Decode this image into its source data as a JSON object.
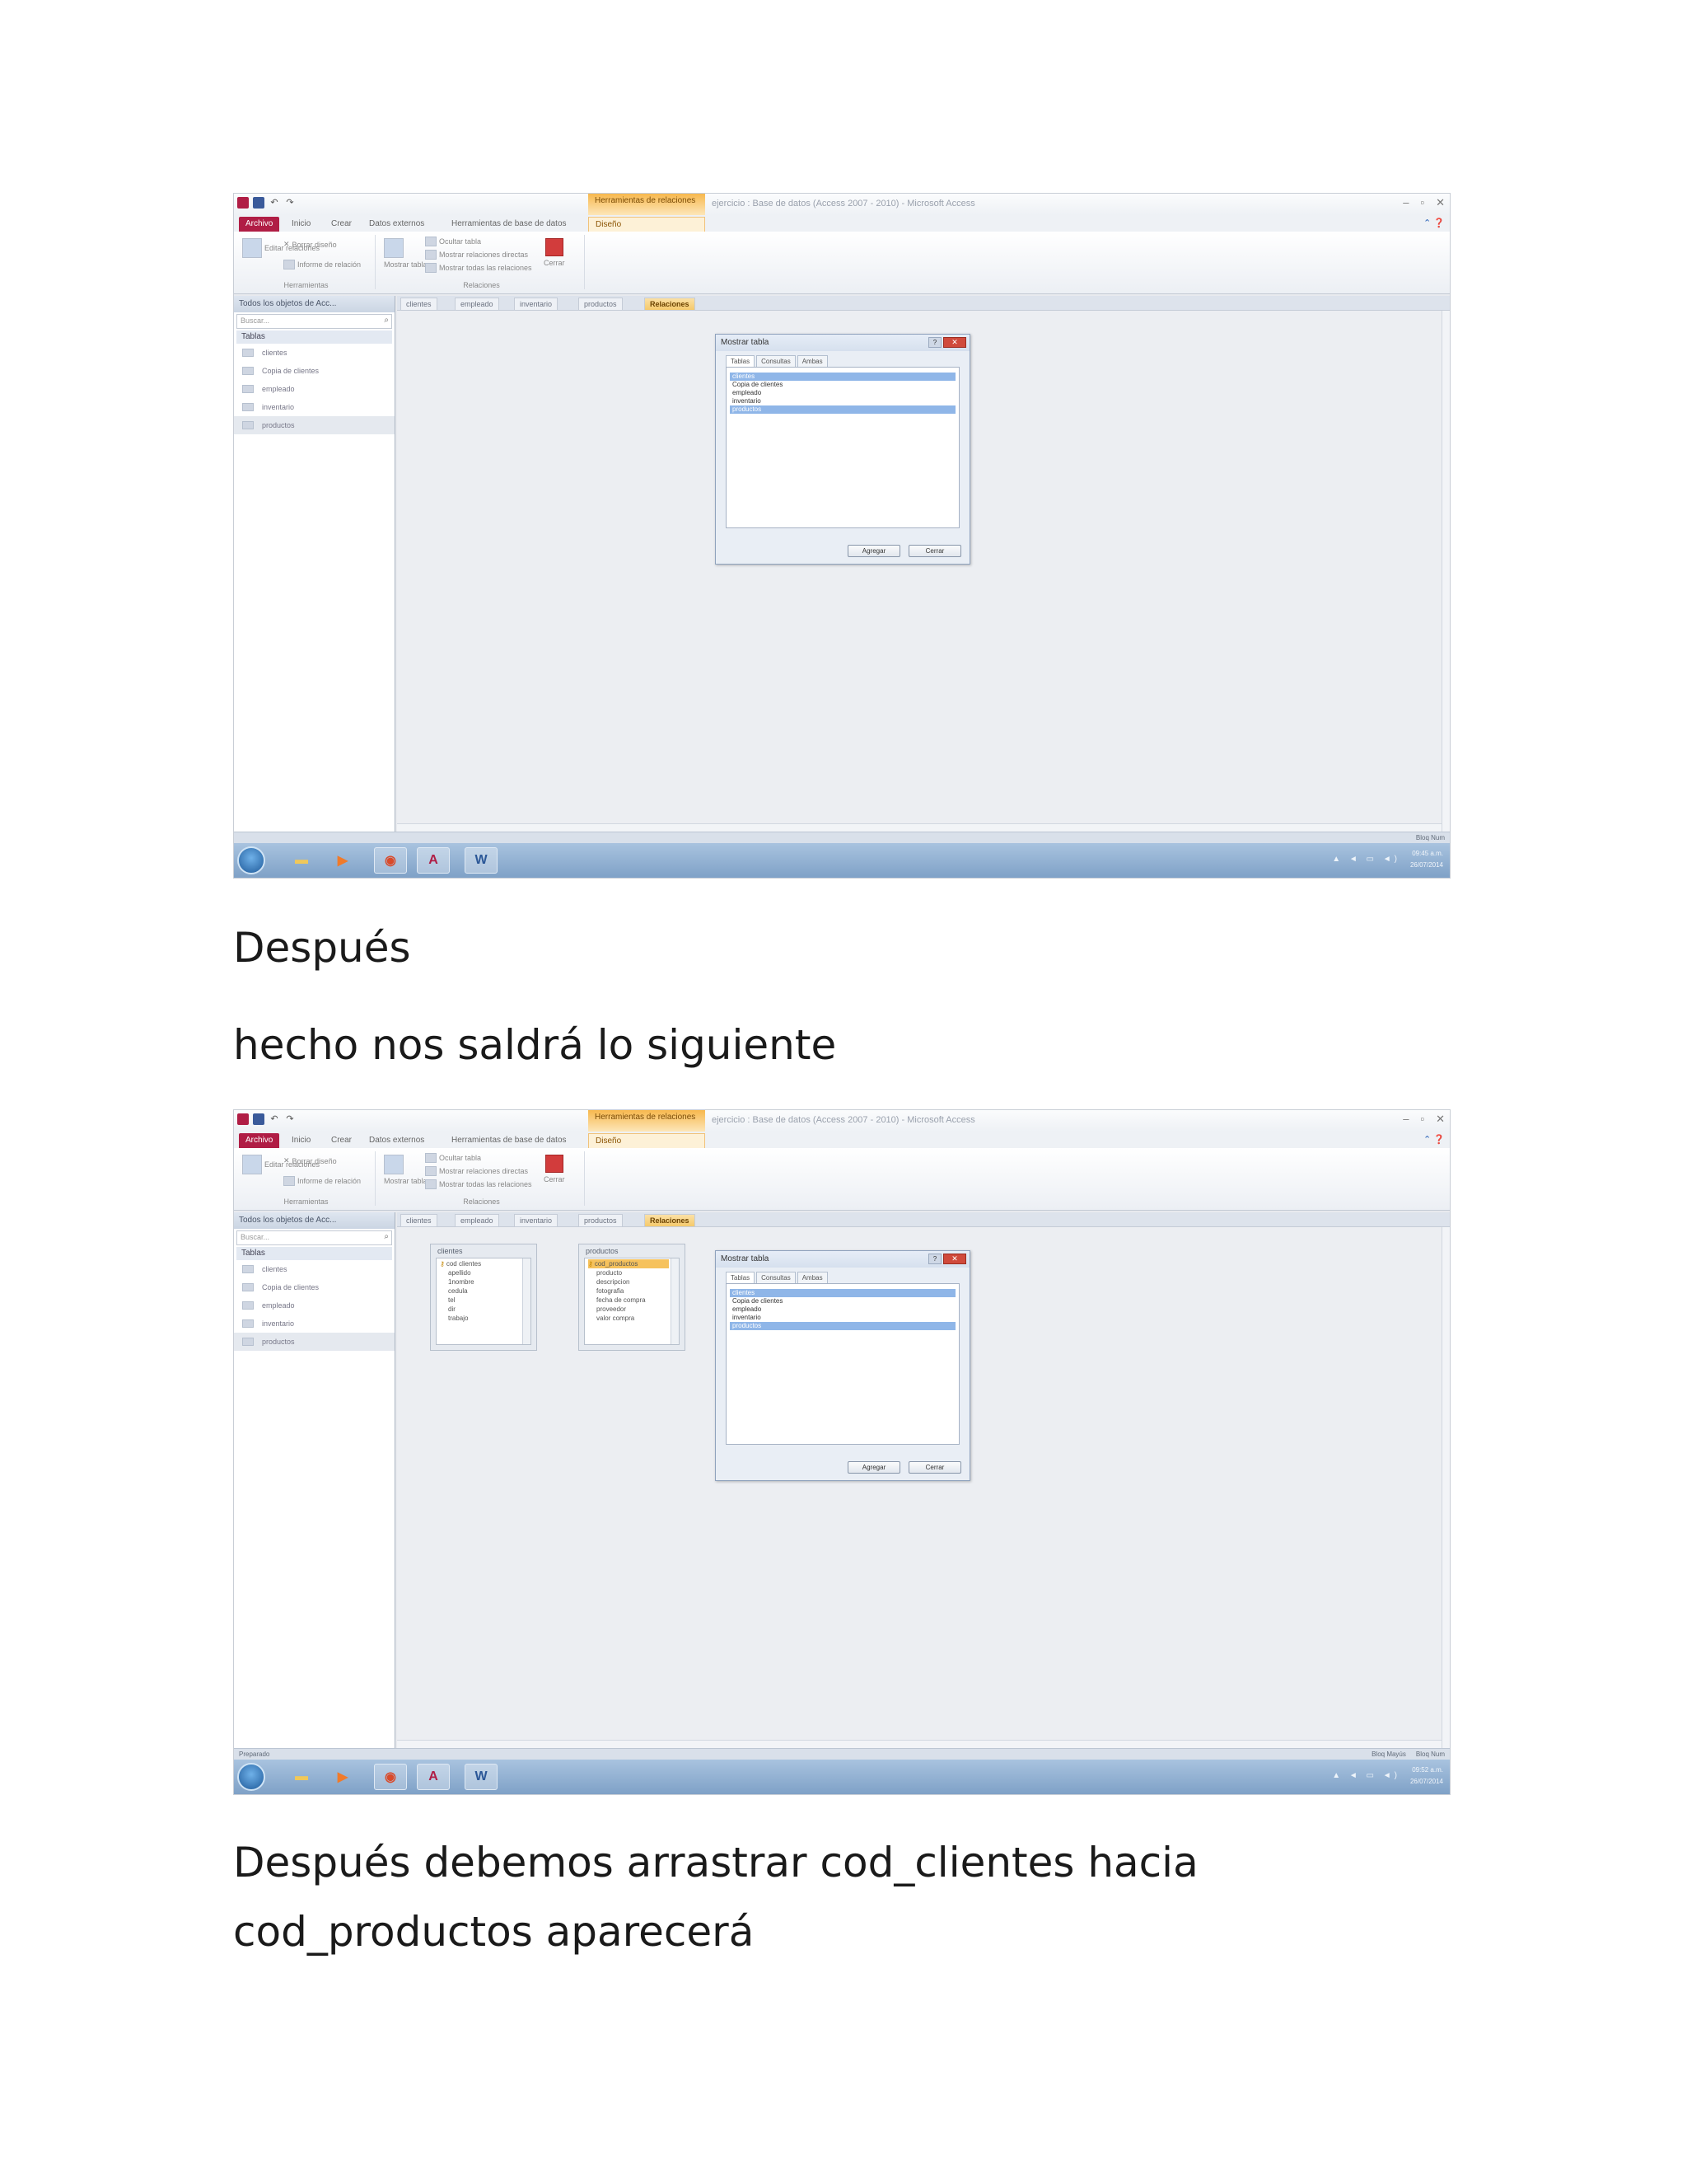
{
  "text": {
    "p1": "Después",
    "p2": "hecho nos saldrá lo siguiente",
    "p3a": "Después debemos arrastrar cod_clientes  hacia",
    "p3b": "cod_productos  aparecerá"
  },
  "access": {
    "title_bar": "ejercicio : Base de datos (Access 2007 - 2010) - Microsoft Access",
    "context_tab": "Herramientas de relaciones",
    "ribbon_tabs": [
      "Archivo",
      "Inicio",
      "Crear",
      "Datos externos",
      "Herramientas de base de datos",
      "Diseño"
    ],
    "ribbon": {
      "editar": "Editar relaciones",
      "borrar": "Borrar diseño",
      "informe": "Informe de relación",
      "mostrar_tabla": "Mostrar tabla",
      "ocultar": "Ocultar tabla",
      "directas": "Mostrar relaciones directas",
      "todas": "Mostrar todas las relaciones",
      "cerrar": "Cerrar",
      "grp_herramientas": "Herramientas",
      "grp_relaciones": "Relaciones"
    },
    "nav": {
      "header": "Todos los objetos de Acc...",
      "search_placeholder": "Buscar...",
      "group": "Tablas",
      "items": [
        "clientes",
        "Copia de clientes",
        "empleado",
        "inventario",
        "productos"
      ]
    },
    "doc_tabs": [
      "clientes",
      "empleado",
      "inventario",
      "productos",
      "Relaciones"
    ],
    "dialog": {
      "title": "Mostrar tabla",
      "tabs": [
        "Tablas",
        "Consultas",
        "Ambas"
      ],
      "items": [
        "clientes",
        "Copia de clientes",
        "empleado",
        "inventario",
        "productos"
      ],
      "add": "Agregar",
      "close": "Cerrar",
      "question": "?",
      "close_x": "✕"
    },
    "field_clientes": {
      "title": "clientes",
      "fields": [
        "cod clientes",
        "apellido",
        "1nombre",
        "cedula",
        "tel",
        "dir",
        "trabajo"
      ]
    },
    "field_productos": {
      "title": "productos",
      "fields": [
        "cod_productos",
        "producto",
        "descripcion",
        "fotografia",
        "fecha de compra",
        "proveedor",
        "valor compra"
      ]
    },
    "status": {
      "ready": "Preparado",
      "num_lock": "Bloq Mayús",
      "bloq_num": "Bloq Num"
    },
    "taskbar": {
      "time": "09:45 a.m.",
      "time2": "09:52 a.m.",
      "date": "26/07/2014",
      "tray": "▲ ◄ ▭ ◄)"
    }
  }
}
